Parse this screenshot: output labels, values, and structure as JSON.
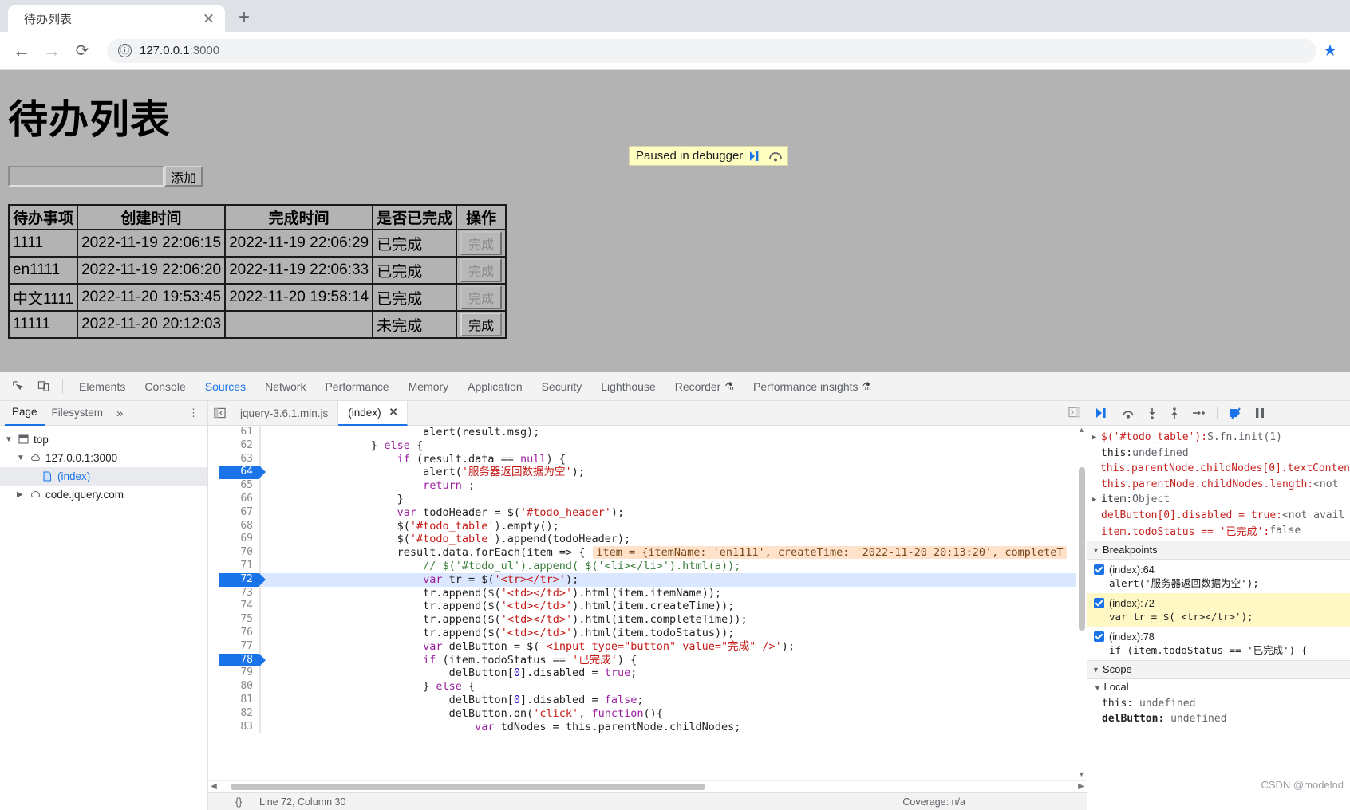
{
  "browser": {
    "tab_title": "待办列表",
    "url_host": "127.0.0.1",
    "url_rest": ":3000",
    "new_tab_label": "+",
    "back_icon": "←",
    "forward_icon": "→",
    "reload_icon": "⟳",
    "info_icon": "ⓘ",
    "star_icon": "★",
    "close_icon": "×"
  },
  "page": {
    "heading": "待办列表",
    "input_value": "",
    "input_placeholder": "",
    "add_button": "添加",
    "table": {
      "headers": [
        "待办事项",
        "创建时间",
        "完成时间",
        "是否已完成",
        "操作"
      ],
      "rows": [
        {
          "name": "1111",
          "create": "2022-11-19 22:06:15",
          "complete": "2022-11-19 22:06:29",
          "status": "已完成",
          "action": "完成",
          "disabled": true
        },
        {
          "name": "en1111",
          "create": "2022-11-19 22:06:20",
          "complete": "2022-11-19 22:06:33",
          "status": "已完成",
          "action": "完成",
          "disabled": true
        },
        {
          "name": "中文1111",
          "create": "2022-11-20 19:53:45",
          "complete": "2022-11-20 19:58:14",
          "status": "已完成",
          "action": "完成",
          "disabled": true
        },
        {
          "name": "11111",
          "create": "2022-11-20 20:12:03",
          "complete": "",
          "status": "未完成",
          "action": "完成",
          "disabled": false
        }
      ]
    },
    "paused_banner": {
      "text": "Paused in debugger",
      "resume_icon": "resume-script-icon",
      "step_icon": "step-over-icon"
    }
  },
  "devtools": {
    "tabs": [
      {
        "label": "Elements",
        "active": false
      },
      {
        "label": "Console",
        "active": false
      },
      {
        "label": "Sources",
        "active": true
      },
      {
        "label": "Network",
        "active": false
      },
      {
        "label": "Performance",
        "active": false
      },
      {
        "label": "Memory",
        "active": false
      },
      {
        "label": "Application",
        "active": false
      },
      {
        "label": "Security",
        "active": false
      },
      {
        "label": "Lighthouse",
        "active": false
      },
      {
        "label": "Recorder",
        "active": false,
        "flask": true
      },
      {
        "label": "Performance insights",
        "active": false,
        "flask": true
      }
    ],
    "navigator": {
      "tabs": [
        {
          "label": "Page",
          "active": true
        },
        {
          "label": "Filesystem",
          "active": false
        }
      ],
      "more": "»",
      "kebab": "⋮",
      "tree": [
        {
          "depth": 0,
          "twisty": "▼",
          "icon": "window-icon",
          "label": "top",
          "blue": false,
          "selected": false
        },
        {
          "depth": 1,
          "twisty": "▼",
          "icon": "cloud-icon",
          "label": "127.0.0.1:3000",
          "blue": false,
          "selected": false
        },
        {
          "depth": 2,
          "twisty": "",
          "icon": "file-icon",
          "label": "(index)",
          "blue": true,
          "selected": true
        },
        {
          "depth": 1,
          "twisty": "▶",
          "icon": "cloud-icon",
          "label": "code.jquery.com",
          "blue": false,
          "selected": false
        }
      ]
    },
    "editor": {
      "tabs": [
        {
          "label": "jquery-3.6.1.min.js",
          "active": false,
          "closable": false
        },
        {
          "label": "(index)",
          "active": true,
          "closable": true,
          "close": "✕"
        }
      ],
      "status": "Line 72, Column 30",
      "coverage": "Coverage: n/a",
      "format_icon": "{}",
      "lines": [
        {
          "n": 61,
          "bp": false,
          "current": false,
          "indent": 24,
          "code": "alert(result.msg);"
        },
        {
          "n": 62,
          "bp": false,
          "current": false,
          "indent": 16,
          "code": "} else {"
        },
        {
          "n": 63,
          "bp": false,
          "current": false,
          "indent": 20,
          "code": "if (result.data == null) {"
        },
        {
          "n": 64,
          "bp": true,
          "current": false,
          "indent": 24,
          "code": "alert('服务器返回数据为空');"
        },
        {
          "n": 65,
          "bp": false,
          "current": false,
          "indent": 24,
          "code": "return ;"
        },
        {
          "n": 66,
          "bp": false,
          "current": false,
          "indent": 20,
          "code": "}"
        },
        {
          "n": 67,
          "bp": false,
          "current": false,
          "indent": 20,
          "code": "var todoHeader = $('#todo_header');"
        },
        {
          "n": 68,
          "bp": false,
          "current": false,
          "indent": 20,
          "code": "$('#todo_table').empty();"
        },
        {
          "n": 69,
          "bp": false,
          "current": false,
          "indent": 20,
          "code": "$('#todo_table').append(todoHeader);"
        },
        {
          "n": 70,
          "bp": false,
          "current": false,
          "indent": 20,
          "code": "result.data.forEach(item => {",
          "hint": "item = {itemName: 'en1111', createTime: '2022-11-20 20:13:20', completeT"
        },
        {
          "n": 71,
          "bp": false,
          "current": false,
          "indent": 24,
          "code": "// $('#todo_ul').append( $('<li></li>').html(a));"
        },
        {
          "n": 72,
          "bp": true,
          "current": true,
          "indent": 24,
          "code": "var tr = $('<tr></tr>');"
        },
        {
          "n": 73,
          "bp": false,
          "current": false,
          "indent": 24,
          "code": "tr.append($('<td></td>').html(item.itemName));"
        },
        {
          "n": 74,
          "bp": false,
          "current": false,
          "indent": 24,
          "code": "tr.append($('<td></td>').html(item.createTime));"
        },
        {
          "n": 75,
          "bp": false,
          "current": false,
          "indent": 24,
          "code": "tr.append($('<td></td>').html(item.completeTime));"
        },
        {
          "n": 76,
          "bp": false,
          "current": false,
          "indent": 24,
          "code": "tr.append($('<td></td>').html(item.todoStatus));"
        },
        {
          "n": 77,
          "bp": false,
          "current": false,
          "indent": 24,
          "code": "var delButton = $('<input type=\"button\" value=\"完成\" />');"
        },
        {
          "n": 78,
          "bp": true,
          "current": false,
          "indent": 24,
          "code": "if (item.todoStatus == '已完成') {"
        },
        {
          "n": 79,
          "bp": false,
          "current": false,
          "indent": 28,
          "code": "delButton[0].disabled = true;"
        },
        {
          "n": 80,
          "bp": false,
          "current": false,
          "indent": 24,
          "code": "} else {"
        },
        {
          "n": 81,
          "bp": false,
          "current": false,
          "indent": 28,
          "code": "delButton[0].disabled = false;"
        },
        {
          "n": 82,
          "bp": false,
          "current": false,
          "indent": 28,
          "code": "delButton.on('click', function(){"
        },
        {
          "n": 83,
          "bp": false,
          "current": false,
          "indent": 32,
          "code": "var tdNodes = this.parentNode.childNodes;"
        }
      ]
    },
    "debugger": {
      "toolbar_icons": [
        {
          "name": "resume-script-execution-icon",
          "glyph": "▶|"
        },
        {
          "name": "step-over-next-function-icon",
          "glyph": "↷"
        },
        {
          "name": "step-into-next-function-icon",
          "glyph": "↓"
        },
        {
          "name": "step-out-of-function-icon",
          "glyph": "↑"
        },
        {
          "name": "step-icon",
          "glyph": "→•"
        },
        {
          "name": "deactivate-breakpoints-icon",
          "glyph": "⫽"
        },
        {
          "name": "pause-on-exceptions-icon",
          "glyph": "❙❙"
        }
      ],
      "watch_expressions": [
        {
          "caret": "▶",
          "name": "$('#todo_table')",
          "sep": ": ",
          "value": "S.fn.init(1)",
          "style": "red"
        },
        {
          "caret": "",
          "name": "this",
          "sep": ": ",
          "value": "undefined",
          "style": "dark"
        },
        {
          "caret": "",
          "name": "this.parentNode.childNodes[0].textConten",
          "sep": "",
          "value": "",
          "style": "red"
        },
        {
          "caret": "",
          "name": "this.parentNode.childNodes.length",
          "sep": ": ",
          "value": "<not",
          "style": "red"
        },
        {
          "caret": "▶",
          "name": "item",
          "sep": ": ",
          "value": "Object",
          "style": "dark"
        },
        {
          "caret": "",
          "name": "delButton[0].disabled = true",
          "sep": ": ",
          "value": "<not avail",
          "style": "red"
        },
        {
          "caret": "",
          "name": "item.todoStatus == '已完成'",
          "sep": ": ",
          "value": "false",
          "style": "red"
        }
      ],
      "breakpoints_header": "Breakpoints",
      "breakpoints": [
        {
          "checked": true,
          "location": "(index):64",
          "code": "alert('服务器返回数据为空');",
          "active": false
        },
        {
          "checked": true,
          "location": "(index):72",
          "code": "var tr = $('<tr></tr>');",
          "active": true
        },
        {
          "checked": true,
          "location": "(index):78",
          "code": "if (item.todoStatus == '已完成') {",
          "active": false
        }
      ],
      "scope_header": "Scope",
      "scope_sub": "Local",
      "scope_rows": [
        {
          "name": "this",
          "sep": ": ",
          "value": "undefined",
          "bold": false
        },
        {
          "name": "delButton",
          "sep": ": ",
          "value": "undefined",
          "bold": true
        }
      ]
    }
  },
  "watermark": "CSDN @modelnd"
}
